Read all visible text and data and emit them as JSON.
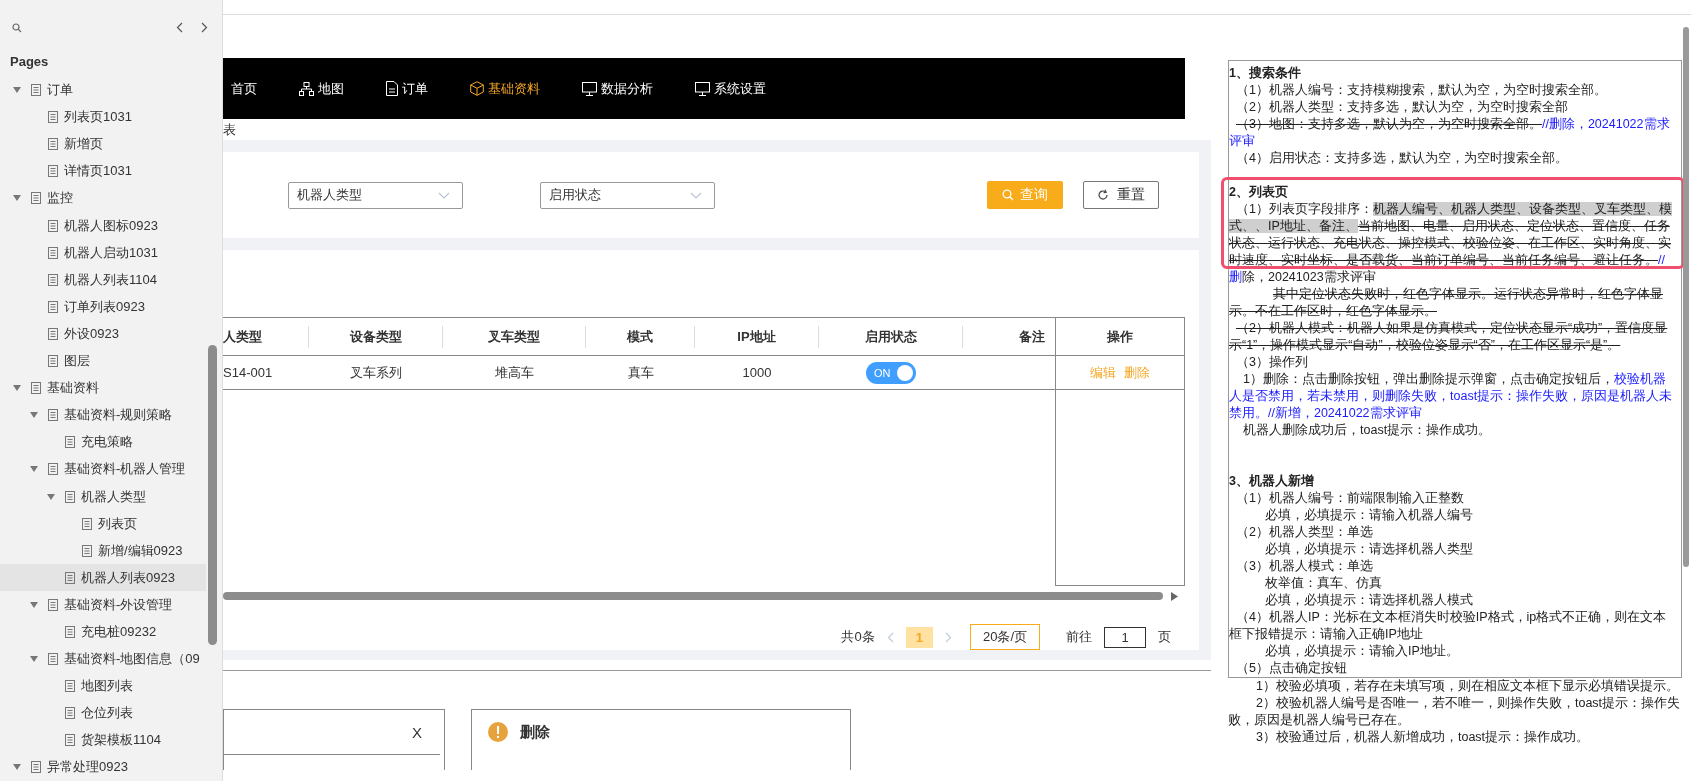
{
  "sidebar": {
    "title": "Pages",
    "tree": [
      {
        "label": "订单",
        "expanded": true,
        "selected": false,
        "children": [
          {
            "label": "列表页1031",
            "selected": false
          },
          {
            "label": "新增页",
            "selected": false
          },
          {
            "label": "详情页1031",
            "selected": false
          }
        ]
      },
      {
        "label": "监控",
        "expanded": true,
        "selected": false,
        "children": [
          {
            "label": "机器人图标0923",
            "selected": false
          },
          {
            "label": "机器人启动1031",
            "selected": false
          },
          {
            "label": "机器人列表1104",
            "selected": false
          },
          {
            "label": "订单列表0923",
            "selected": false
          },
          {
            "label": "外设0923",
            "selected": false
          },
          {
            "label": "图层",
            "selected": false
          }
        ]
      },
      {
        "label": "基础资料",
        "expanded": true,
        "selected": false,
        "children": [
          {
            "label": "基础资料-规则策略",
            "expanded": true,
            "selected": false,
            "children": [
              {
                "label": "充电策略",
                "selected": false
              }
            ]
          },
          {
            "label": "基础资料-机器人管理",
            "expanded": true,
            "selected": false,
            "children": [
              {
                "label": "机器人类型",
                "expanded": true,
                "selected": false,
                "children": [
                  {
                    "label": "列表页",
                    "selected": false
                  },
                  {
                    "label": "新增/编辑0923",
                    "selected": false
                  }
                ]
              },
              {
                "label": "机器人列表0923",
                "selected": true
              }
            ]
          },
          {
            "label": "基础资料-外设管理",
            "expanded": true,
            "selected": false,
            "children": [
              {
                "label": "充电桩09232",
                "selected": false
              }
            ]
          },
          {
            "label": "基础资料-地图信息（09",
            "expanded": true,
            "selected": false,
            "children": [
              {
                "label": "地图列表",
                "selected": false
              },
              {
                "label": "仓位列表",
                "selected": false
              },
              {
                "label": "货架模板1104",
                "selected": false
              }
            ]
          }
        ]
      },
      {
        "label": "异常处理0923",
        "expanded": true,
        "selected": false
      }
    ]
  },
  "nav": {
    "items": [
      {
        "label": "首页",
        "selected": false
      },
      {
        "label": "地图",
        "selected": false
      },
      {
        "label": "订单",
        "selected": false
      },
      {
        "label": "基础资料",
        "selected": true
      },
      {
        "label": "数据分析",
        "selected": false
      },
      {
        "label": "系统设置",
        "selected": false
      }
    ]
  },
  "breadcrumb": "表",
  "filters": [
    {
      "placeholder": "机器人类型"
    },
    {
      "placeholder": "启用状态"
    }
  ],
  "buttons": {
    "query": "查询",
    "reset": "重置"
  },
  "table": {
    "columns": [
      "人类型",
      "设备类型",
      "叉车类型",
      "模式",
      "IP地址",
      "启用状态",
      "备注"
    ],
    "action_column": "操作",
    "rows": [
      {
        "cells": [
          "S14-001",
          "叉车系列",
          "堆高车",
          "真车",
          "1000"
        ],
        "status": {
          "label": "ON",
          "on": true
        },
        "actions": [
          "编辑",
          "删除"
        ]
      }
    ]
  },
  "pagination": {
    "total": "共0条",
    "pages": [
      {
        "label": "1",
        "selected": true
      }
    ],
    "page_size": "20条/页",
    "goto": "前往",
    "goto_value": "1",
    "unit": "页"
  },
  "dialogs": {
    "close": "X",
    "delete_title": "删除"
  },
  "notes": {
    "paragraphs": [
      {
        "kind": "heading",
        "segments": [
          {
            "kind": "plain",
            "text": "1、搜索条件"
          }
        ]
      },
      {
        "kind": "item",
        "segments": [
          {
            "kind": "plain",
            "text": "（1）机器人编号：支持模糊搜索，默认为空，为空时搜索全部。"
          }
        ]
      },
      {
        "kind": "item",
        "segments": [
          {
            "kind": "plain",
            "text": "（2）机器人类型：支持多选，默认为空，为空时搜索全部"
          }
        ]
      },
      {
        "kind": "item",
        "segments": [
          {
            "kind": "deleted",
            "text": "（3）地图：支持多选，默认为空，为空时搜索全部。"
          },
          {
            "kind": "comment",
            "text": "//删除，20241022需求评审"
          }
        ]
      },
      {
        "kind": "item",
        "segments": [
          {
            "kind": "plain",
            "text": "（4）启用状态：支持多选，默认为空，为空时搜索全部。"
          }
        ]
      },
      {
        "kind": "marked",
        "segments": [
          {
            "kind": "plain",
            "text": "2、列表页"
          }
        ]
      },
      {
        "kind": "item",
        "segments": [
          {
            "kind": "plain",
            "text": "（1）列表页字段排序："
          },
          {
            "kind": "selection",
            "text": "机器人编号、机器人类型、设备类型、叉车类型、模式、、IP地址、备注、"
          },
          {
            "kind": "deleted",
            "text": "当前地图、电量、启用状态、定位状态、置信度、任务状态、运行状态、充电状态、操控模式、校验位姿、在工作区、实时角度、实时速度、实时坐标、是否载货、当前订单编号、当前任务编号、避让任务。"
          },
          {
            "kind": "comment",
            "text": "//删"
          },
          {
            "kind": "plain",
            "text": "除，20241023需求评审"
          }
        ]
      },
      {
        "kind": "detail",
        "segments": [
          {
            "kind": "deleted",
            "text": "其中定位状态失败时，红色字体显示。运行状态异常时，红色字体显示。不在工作区时，红色字体显示。"
          }
        ]
      },
      {
        "kind": "item",
        "segments": [
          {
            "kind": "deleted",
            "text": "（2）机器人模式：机器人如果是仿真模式，定位状态显示“成功”，置信度显示“1”，操作模式显示“自动”，校验位姿显示“否”，在工作区显示“是”。"
          }
        ]
      },
      {
        "kind": "item",
        "segments": [
          {
            "kind": "plain",
            "text": "（3）操作列"
          }
        ]
      },
      {
        "kind": "sub",
        "segments": [
          {
            "kind": "plain",
            "text": "1）删除：点击删除按钮，弹出删除提示弹窗，点击确定按钮后，"
          },
          {
            "kind": "comment",
            "text": "校验机器人是否禁用，若未禁用，则删除失败，toast提示：操作失败，原因是机器人未禁用。//新增，20241022需求评审"
          }
        ]
      },
      {
        "kind": "sub",
        "segments": [
          {
            "kind": "plain",
            "text": "机器人删除成功后，toast提示：操作成功。"
          }
        ]
      },
      {
        "kind": "section",
        "segments": [
          {
            "kind": "plain",
            "text": "3、机器人新增"
          }
        ]
      },
      {
        "kind": "item",
        "segments": [
          {
            "kind": "plain",
            "text": "（1）机器人编号：前端限制输入正整数"
          }
        ]
      },
      {
        "kind": "field",
        "segments": [
          {
            "kind": "plain",
            "text": "必填，必填提示：请输入机器人编号"
          }
        ]
      },
      {
        "kind": "item",
        "segments": [
          {
            "kind": "plain",
            "text": "（2）机器人类型：单选"
          }
        ]
      },
      {
        "kind": "field",
        "segments": [
          {
            "kind": "plain",
            "text": "必填，必填提示：请选择机器人类型"
          }
        ]
      },
      {
        "kind": "item",
        "segments": [
          {
            "kind": "plain",
            "text": "（3）机器人模式：单选"
          }
        ]
      },
      {
        "kind": "field",
        "segments": [
          {
            "kind": "plain",
            "text": "枚举值：真车、仿真"
          }
        ]
      },
      {
        "kind": "field",
        "segments": [
          {
            "kind": "plain",
            "text": "必填，必填提示：请选择机器人模式"
          }
        ]
      },
      {
        "kind": "item",
        "segments": [
          {
            "kind": "plain",
            "text": "（4）机器人IP：光标在文本框消失时校验IP格式，ip格式不正确，则在文本框下报错提示：请输入正确IP地址"
          }
        ]
      },
      {
        "kind": "field",
        "segments": [
          {
            "kind": "plain",
            "text": "必填，必填提示：请输入IP地址。"
          }
        ]
      },
      {
        "kind": "item",
        "segments": [
          {
            "kind": "plain",
            "text": "（5）点击确定按钮"
          }
        ]
      }
    ],
    "overflow": [
      "1）校验必填项，若存在未填写项，则在相应文本框下显示必填错误提示。",
      "2）校验机器人编号是否唯一，若不唯一，则操作失败，toast提示：操作失败，原因是机器人编号已存在。",
      "3）校验通过后，机器人新增成功，toast提示：操作成功。"
    ]
  }
}
